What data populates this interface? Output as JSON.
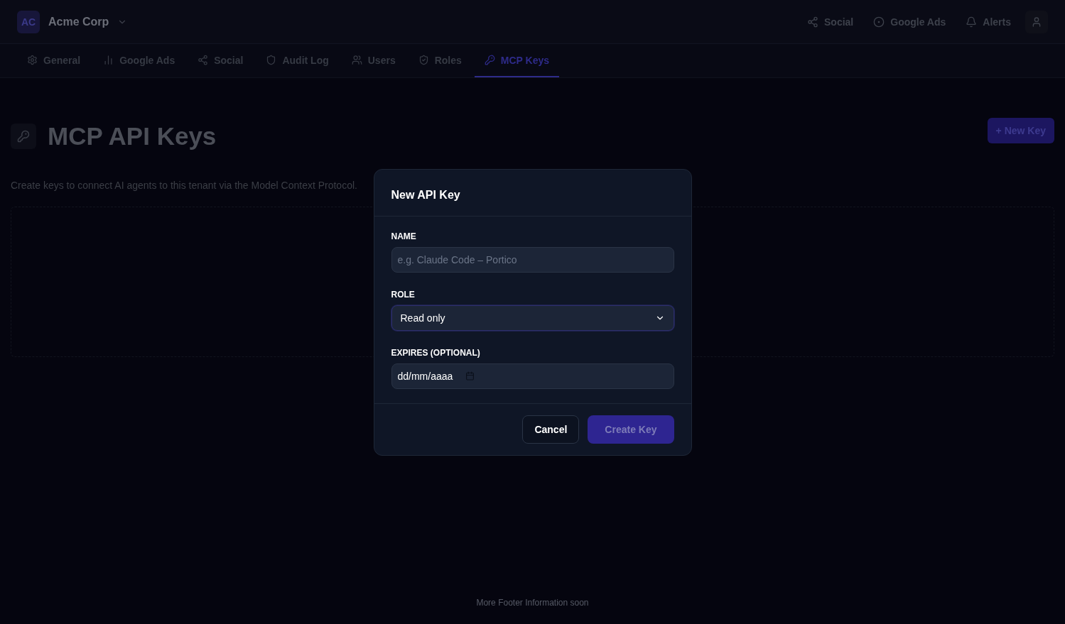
{
  "header": {
    "initials": "AC",
    "org": "Acme Corp",
    "links": [
      "Social",
      "Google Ads",
      "Alerts"
    ]
  },
  "tabs": [
    {
      "label": "General",
      "selected": false
    },
    {
      "label": "Google Ads",
      "selected": false
    },
    {
      "label": "Social",
      "selected": false
    },
    {
      "label": "Audit Log",
      "selected": false
    },
    {
      "label": "Users",
      "selected": false
    },
    {
      "label": "Roles",
      "selected": false
    },
    {
      "label": "MCP Keys",
      "selected": true
    }
  ],
  "page": {
    "title": "MCP API Keys",
    "new_button": "+ New Key",
    "description": "Create keys to connect AI agents to this tenant via the Model Context Protocol."
  },
  "dialog": {
    "title": "New API Key",
    "fields": [
      {
        "kind": "text",
        "label": "NAME",
        "placeholder": "e.g. Claude Code – Portico"
      },
      {
        "kind": "select",
        "label": "ROLE",
        "value": "Read only"
      },
      {
        "kind": "date",
        "label": "EXPIRES (OPTIONAL)",
        "value": "dd/mm/aaaa"
      }
    ],
    "cancel": "Cancel",
    "submit": {
      "label": "Create Key",
      "disabled": true
    }
  },
  "footer": "More Footer Information soon"
}
